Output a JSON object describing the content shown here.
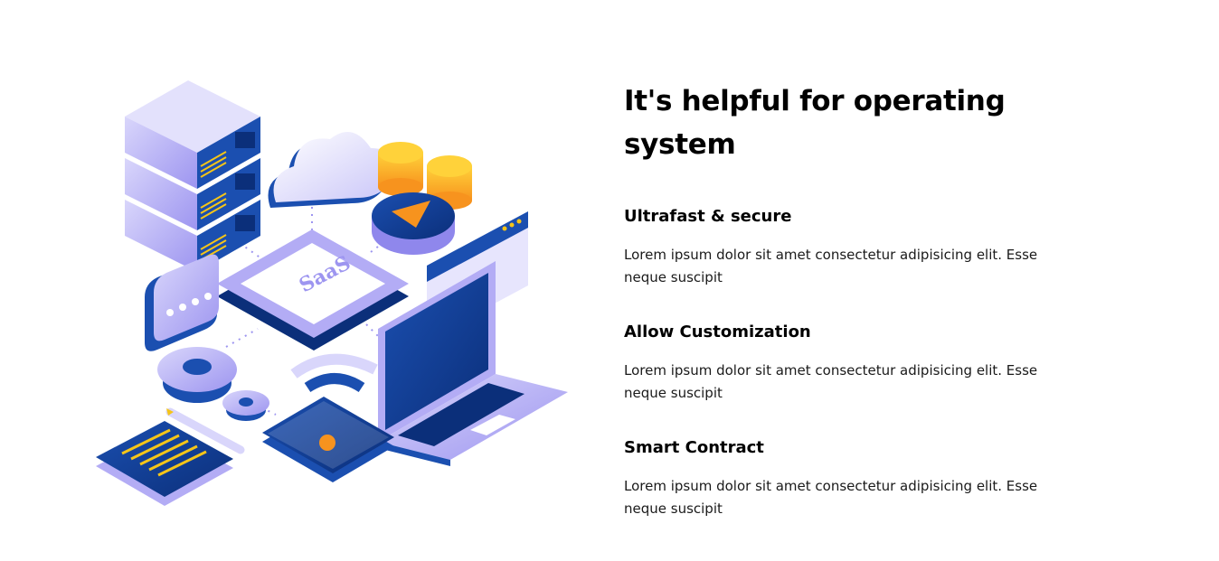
{
  "illustration": {
    "icon": "saas-isometric-illustration",
    "center_label": "SaaS",
    "colors": {
      "primary_dark": "#0c3a8f",
      "primary": "#1b4fb0",
      "lavender": "#b3acf5",
      "lavender_light": "#d9d6fb",
      "accent_yellow": "#f5c518",
      "accent_orange": "#f7931e"
    }
  },
  "main": {
    "title": "It's helpful for operating system",
    "features": [
      {
        "title": "Ultrafast & secure",
        "description": "Lorem ipsum dolor sit amet consectetur adipisicing elit. Esse neque suscipit"
      },
      {
        "title": "Allow Customization",
        "description": "Lorem ipsum dolor sit amet consectetur adipisicing elit. Esse neque suscipit"
      },
      {
        "title": "Smart Contract",
        "description": "Lorem ipsum dolor sit amet consectetur adipisicing elit. Esse neque suscipit"
      }
    ]
  }
}
